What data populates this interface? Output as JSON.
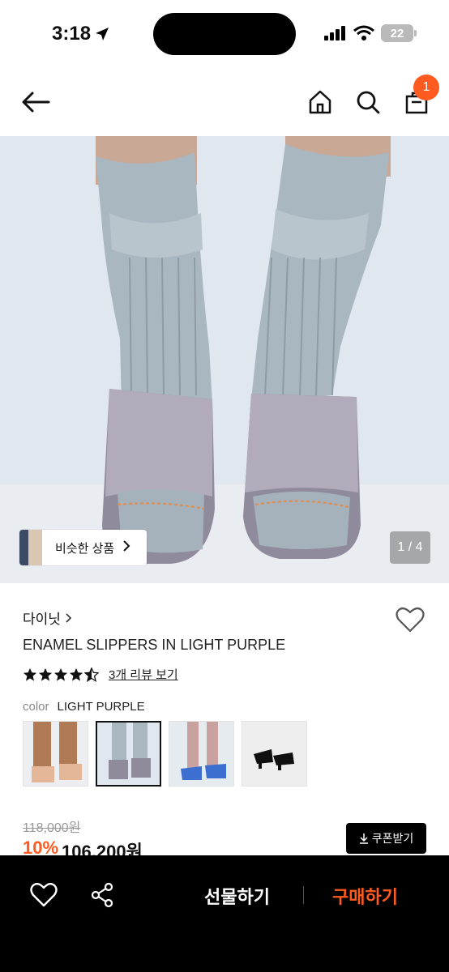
{
  "status_bar": {
    "time": "3:18",
    "battery": "22"
  },
  "header": {
    "cart_badge": "1"
  },
  "gallery": {
    "similar_label": "비슷한 상품",
    "counter": "1 / 4"
  },
  "product": {
    "brand": "다이닛",
    "title": "ENAMEL SLIPPERS IN LIGHT PURPLE",
    "rating": 4.5,
    "review_link": "3개 리뷰 보기",
    "color_key": "color",
    "color_value": "LIGHT PURPLE",
    "swatches": [
      "beige-socks",
      "light-purple",
      "blue",
      "black"
    ],
    "original_price": "118,000원",
    "discount": "10%",
    "sale_price": "106,200원",
    "coupon_label": "쿠폰받기"
  },
  "bottom_bar": {
    "gift_label": "선물하기",
    "buy_label": "구매하기"
  },
  "colors": {
    "accent": "#ff5a1f",
    "bar": "#000000"
  }
}
